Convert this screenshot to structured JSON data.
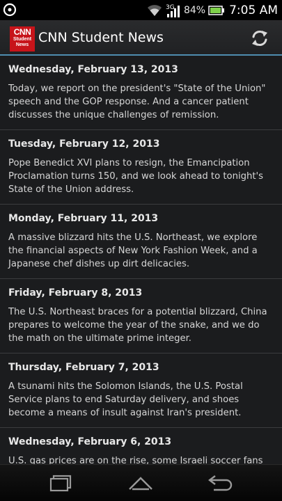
{
  "status_bar": {
    "battery_percent": "84%",
    "time": "7:05 AM",
    "icons": [
      "app-notification-icon",
      "wifi-icon",
      "signal-icon",
      "battery-icon"
    ]
  },
  "action_bar": {
    "logo_line1": "CNN",
    "logo_line2": "Student",
    "logo_line3": "News",
    "title": "CNN Student News",
    "refresh_icon": "refresh-icon"
  },
  "episodes": [
    {
      "date": "Wednesday, February 13, 2013",
      "description": "Today, we report on the president's \"State of the Union\" speech and the GOP response. And a cancer patient discusses the unique challenges of remission."
    },
    {
      "date": "Tuesday, February 12, 2013",
      "description": "Pope Benedict XVI plans to resign, the Emancipation Proclamation turns 150, and we look ahead to tonight's State of the Union address."
    },
    {
      "date": "Monday, February 11, 2013",
      "description": "A massive blizzard hits the U.S. Northeast, we explore the financial aspects of New York Fashion Week, and a Japanese chef dishes up dirt delicacies."
    },
    {
      "date": "Friday, February 8, 2013",
      "description": "The U.S. Northeast braces for a potential blizzard, China prepares to welcome the year of the snake, and we do the math on the ultimate prime integer."
    },
    {
      "date": "Thursday, February 7, 2013",
      "description": "A tsunami hits the Solomon Islands, the U.S. Postal Service plans to end Saturday delivery, and shoes become a means of insult against Iran's president."
    },
    {
      "date": "Wednesday, February 6, 2013",
      "description": "U.S. gas prices are on the rise, some Israeli soccer fans root"
    }
  ],
  "nav_bar": {
    "icons": [
      "recent-apps-icon",
      "home-icon",
      "back-icon"
    ]
  },
  "colors": {
    "background": "#1b1c1e",
    "accent_line": "#4f8db0",
    "cnn_red": "#c7141a",
    "battery_green": "#7ed04a"
  }
}
